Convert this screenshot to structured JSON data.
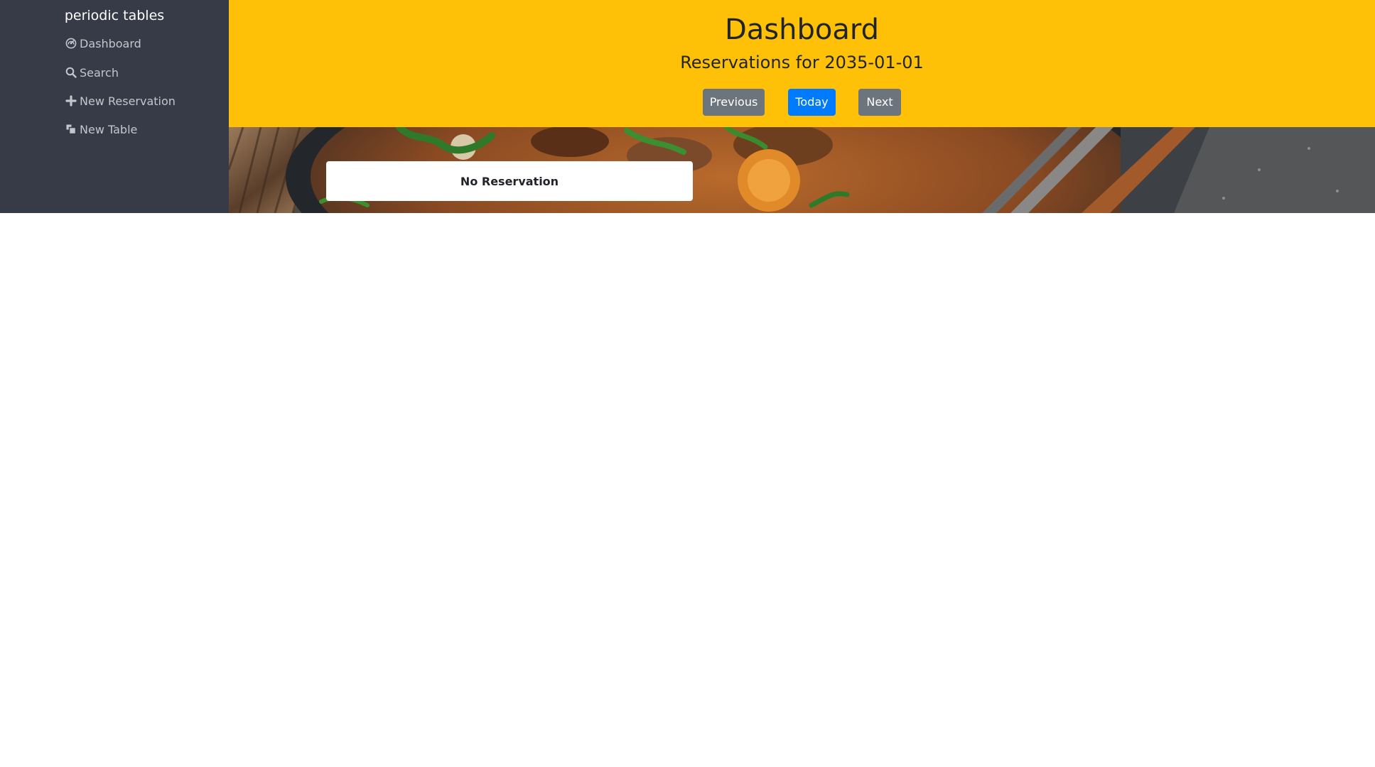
{
  "sidebar": {
    "brand": "periodic tables",
    "items": [
      {
        "label": "Dashboard",
        "icon": "dashboard-icon"
      },
      {
        "label": "Search",
        "icon": "search-icon"
      },
      {
        "label": "New Reservation",
        "icon": "plus-icon"
      },
      {
        "label": "New Table",
        "icon": "new-table-icon"
      }
    ]
  },
  "header": {
    "title": "Dashboard",
    "subtitle": "Reservations for 2035-01-01",
    "buttons": {
      "previous": "Previous",
      "today": "Today",
      "next": "Next"
    }
  },
  "reservations": {
    "empty_text": "No Reservation"
  },
  "colors": {
    "sidebar_bg": "#373a47",
    "header_bg": "#ffc107",
    "primary": "#007bff",
    "secondary": "#6c757d"
  }
}
